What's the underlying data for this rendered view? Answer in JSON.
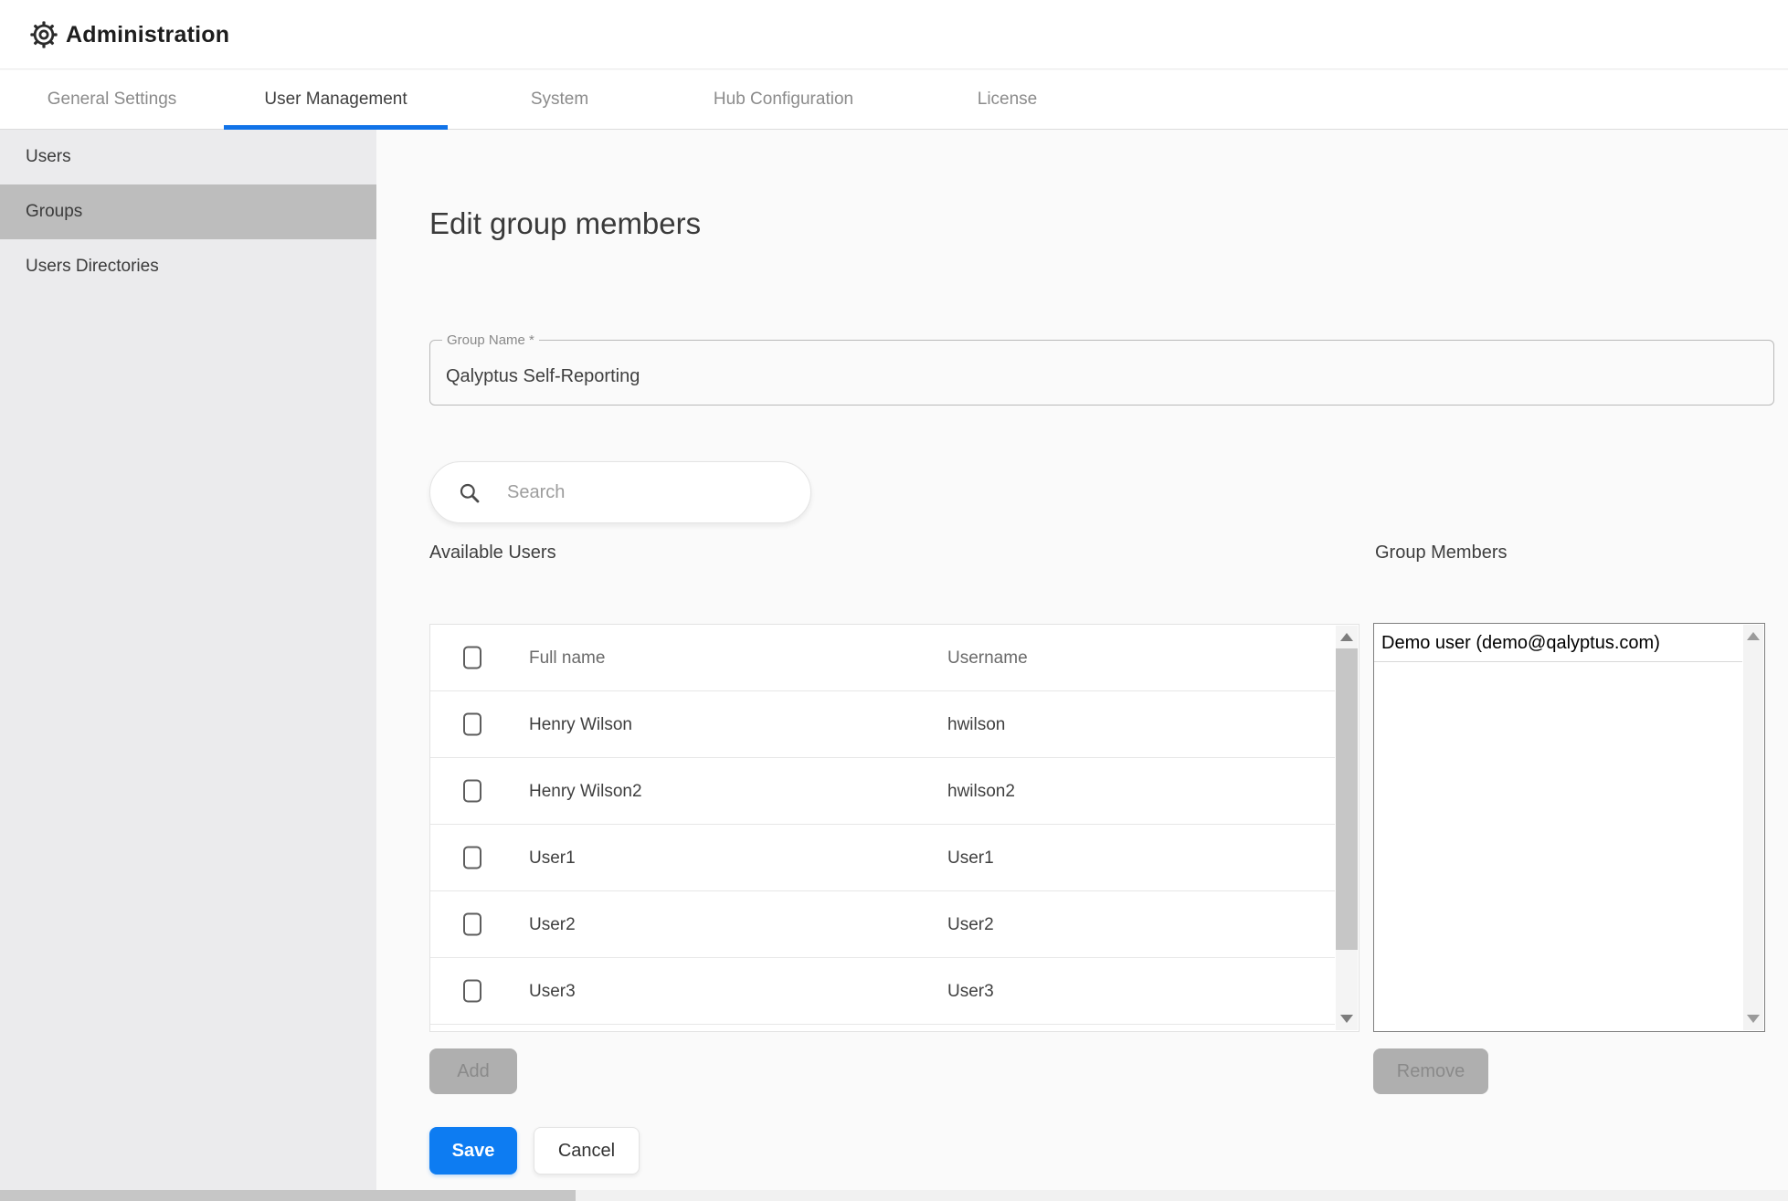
{
  "header": {
    "title": "Administration",
    "icon": "gear-icon"
  },
  "tabs": {
    "items": [
      {
        "label": "General Settings",
        "active": false
      },
      {
        "label": "User Management",
        "active": true
      },
      {
        "label": "System",
        "active": false
      },
      {
        "label": "Hub Configuration",
        "active": false
      },
      {
        "label": "License",
        "active": false
      }
    ]
  },
  "sidebar": {
    "items": [
      {
        "label": "Users",
        "selected": false
      },
      {
        "label": "Groups",
        "selected": true
      },
      {
        "label": "Users Directories",
        "selected": false
      }
    ]
  },
  "main": {
    "heading": "Edit group members",
    "group_name_field": {
      "label": "Group Name *",
      "value": "Qalyptus Self-Reporting"
    },
    "search": {
      "placeholder": "Search",
      "icon": "search-icon"
    },
    "available_users": {
      "title": "Available Users",
      "columns": [
        "Full name",
        "Username"
      ],
      "rows": [
        {
          "full_name": "Henry Wilson",
          "username": "hwilson"
        },
        {
          "full_name": "Henry Wilson2",
          "username": "hwilson2"
        },
        {
          "full_name": "User1",
          "username": "User1"
        },
        {
          "full_name": "User2",
          "username": "User2"
        },
        {
          "full_name": "User3",
          "username": "User3"
        }
      ]
    },
    "group_members": {
      "title": "Group Members",
      "items": [
        "Demo user (demo@qalyptus.com)"
      ]
    },
    "buttons": {
      "add": "Add",
      "remove": "Remove",
      "save": "Save",
      "cancel": "Cancel"
    }
  },
  "colors": {
    "accent_blue": "#0d7cf2",
    "tab_underline": "#1173e8",
    "sidebar_selected": "#bdbdbd",
    "disabled_button": "#afafaf"
  }
}
